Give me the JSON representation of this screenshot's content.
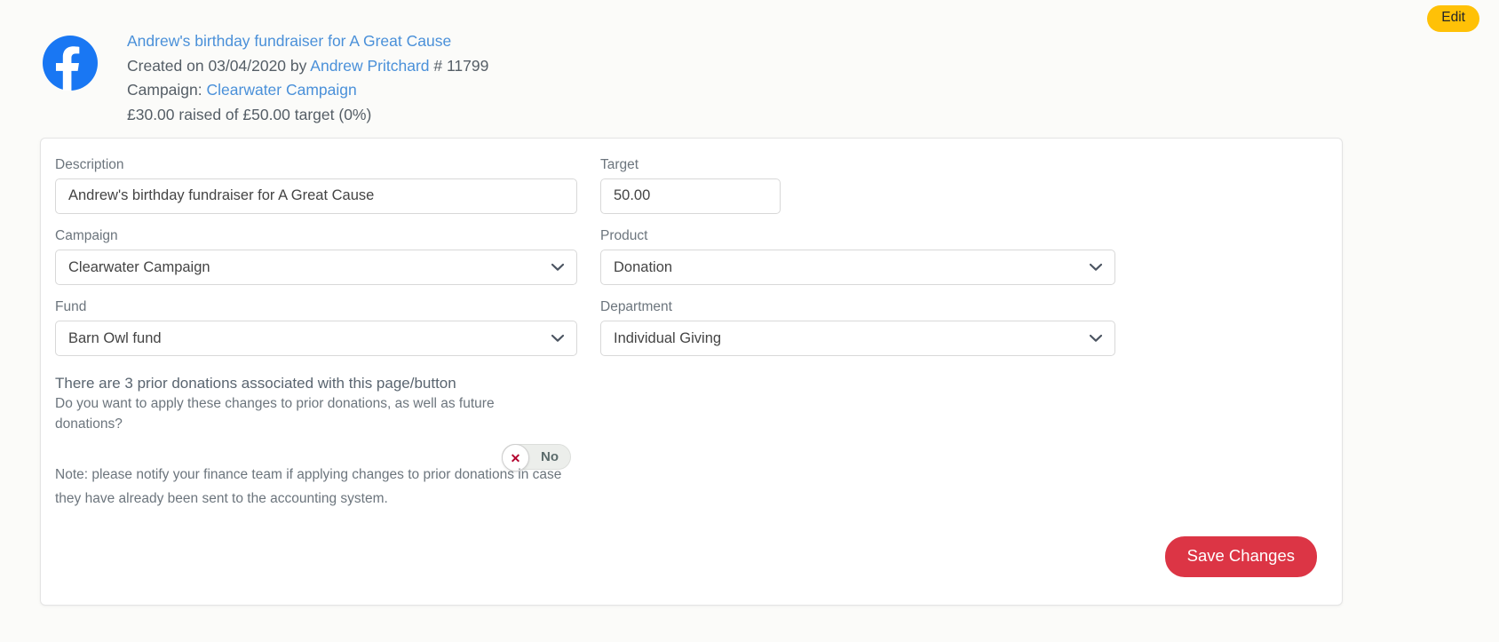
{
  "page": {
    "background_color": "#fbfbf9"
  },
  "top_bar": {
    "edit_label": "Edit",
    "edit_color": "#ffc107"
  },
  "header": {
    "icon": "facebook-icon",
    "icon_color": "#1977f3",
    "title": "Andrew's birthday fundraiser for A Great Cause",
    "created_prefix": "Created on ",
    "created_date": "03/04/2020",
    "created_by_prefix": " by ",
    "created_by": "Andrew Pritchard",
    "reference": "  # 11799",
    "campaign_prefix": "Campaign: ",
    "campaign_name": "Clearwater Campaign",
    "progress": "£30.00 raised of £50.00 target (0%)"
  },
  "form": {
    "description": {
      "label": "Description",
      "value": "Andrew's birthday fundraiser for A Great Cause"
    },
    "campaign": {
      "label": "Campaign",
      "value": "Clearwater Campaign"
    },
    "fund": {
      "label": "Fund",
      "value": "Barn Owl fund"
    },
    "target": {
      "label": "Target",
      "value": "50.00"
    },
    "product": {
      "label": "Product",
      "value": "Donation"
    },
    "department": {
      "label": "Department",
      "value": "Individual Giving"
    }
  },
  "prior_donations": {
    "title": "There are 3 prior donations associated with this page/button",
    "question": "Do you want to apply these changes to prior donations, as well as future donations?",
    "toggle_value": "No",
    "toggle_icon": "cross-icon",
    "toggle_icon_glyph": "✕",
    "toggle_icon_color": "#b3002d"
  },
  "note": {
    "text": "Note: please notify your finance team if applying changes to prior donations in case they have already been sent to the accounting system."
  },
  "actions": {
    "save_label": "Save Changes",
    "save_color": "#dc3545"
  }
}
